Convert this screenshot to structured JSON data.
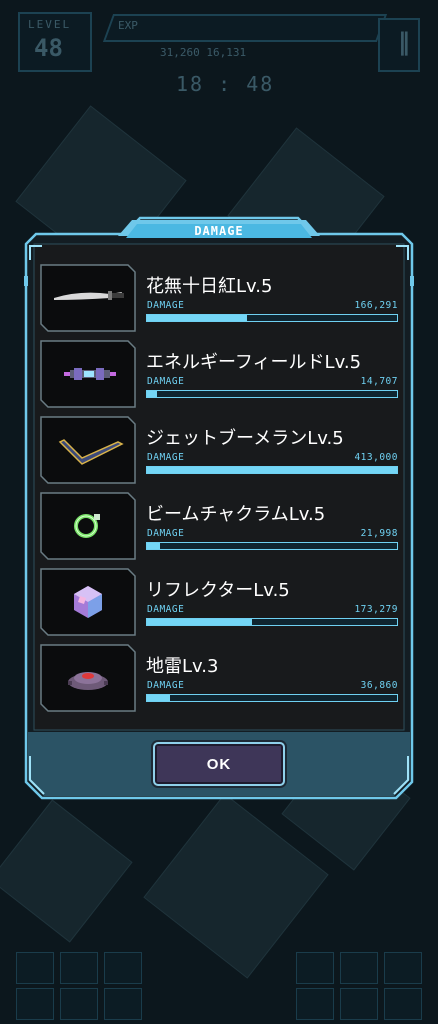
{
  "hud": {
    "level_label": "LEVEL",
    "level": "48",
    "exp_label": "EXP",
    "stats": "31,260  16,131",
    "timer": "18 : 48",
    "pause_icon": "pause-icon"
  },
  "modal": {
    "title": "DAMAGE",
    "ok_label": "OK",
    "items": [
      {
        "name": "花無十日紅Lv.5",
        "damage_label": "DAMAGE",
        "damage": "166,291",
        "progress": 0.4,
        "icon": "katana-icon"
      },
      {
        "name": "エネルギーフィールドLv.5",
        "damage_label": "DAMAGE",
        "damage": "14,707",
        "progress": 0.04,
        "icon": "energy-device-icon"
      },
      {
        "name": "ジェットブーメランLv.5",
        "damage_label": "DAMAGE",
        "damage": "413,000",
        "progress": 1.0,
        "icon": "boomerang-icon"
      },
      {
        "name": "ビームチャクラムLv.5",
        "damage_label": "DAMAGE",
        "damage": "21,998",
        "progress": 0.05,
        "icon": "chakram-icon"
      },
      {
        "name": "リフレクターLv.5",
        "damage_label": "DAMAGE",
        "damage": "173,279",
        "progress": 0.42,
        "icon": "crystal-cube-icon"
      },
      {
        "name": "地雷Lv.3",
        "damage_label": "DAMAGE",
        "damage": "36,860",
        "progress": 0.09,
        "icon": "landmine-icon"
      }
    ]
  },
  "colors": {
    "accent": "#74d6f6",
    "panel": "#141e24",
    "frame": "#6fc8ea",
    "button": "#3e3658"
  }
}
